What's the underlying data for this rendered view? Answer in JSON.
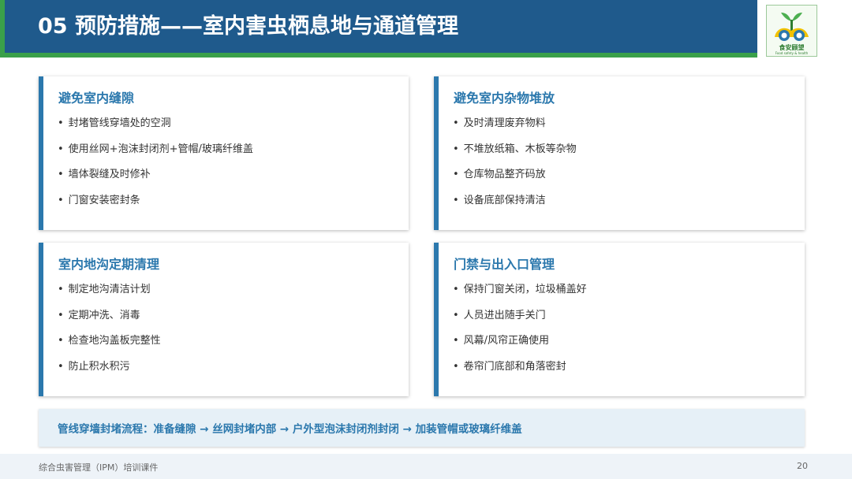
{
  "header": {
    "title": "05  预防措施——室内害虫栖息地与通道管理",
    "logo_text": "食安顾望",
    "logo_subtext": "Food safety & health",
    "accent_color": "#1f5a8c",
    "green_color": "#3aa04a"
  },
  "cards": [
    {
      "title": "避免室内缝隙",
      "items": [
        "封堵管线穿墙处的空洞",
        "使用丝网+泡沫封闭剂+管帽/玻璃纤维盖",
        "墙体裂缝及时修补",
        "门窗安装密封条"
      ]
    },
    {
      "title": "避免室内杂物堆放",
      "items": [
        "及时清理废弃物料",
        "不堆放纸箱、木板等杂物",
        "仓库物品整齐码放",
        "设备底部保持清洁"
      ]
    },
    {
      "title": "室内地沟定期清理",
      "items": [
        "制定地沟清洁计划",
        "定期冲洗、消毒",
        "检查地沟盖板完整性",
        "防止积水积污"
      ]
    },
    {
      "title": "门禁与出入口管理",
      "items": [
        "保持门窗关闭，垃圾桶盖好",
        "人员进出随手关门",
        "风幕/风帘正确使用",
        "卷帘门底部和角落密封"
      ]
    }
  ],
  "flow": {
    "text": "管线穿墙封堵流程：准备缝隙 → 丝网封堵内部 → 户外型泡沫封闭剂封闭 → 加装管帽或玻璃纤维盖"
  },
  "footer": {
    "course": "综合虫害管理（IPM）培训课件",
    "page": "20"
  },
  "colors": {
    "card_accent": "#2b78ad",
    "flow_bg": "#e6f0f7",
    "footer_bg": "#eef3f8"
  }
}
